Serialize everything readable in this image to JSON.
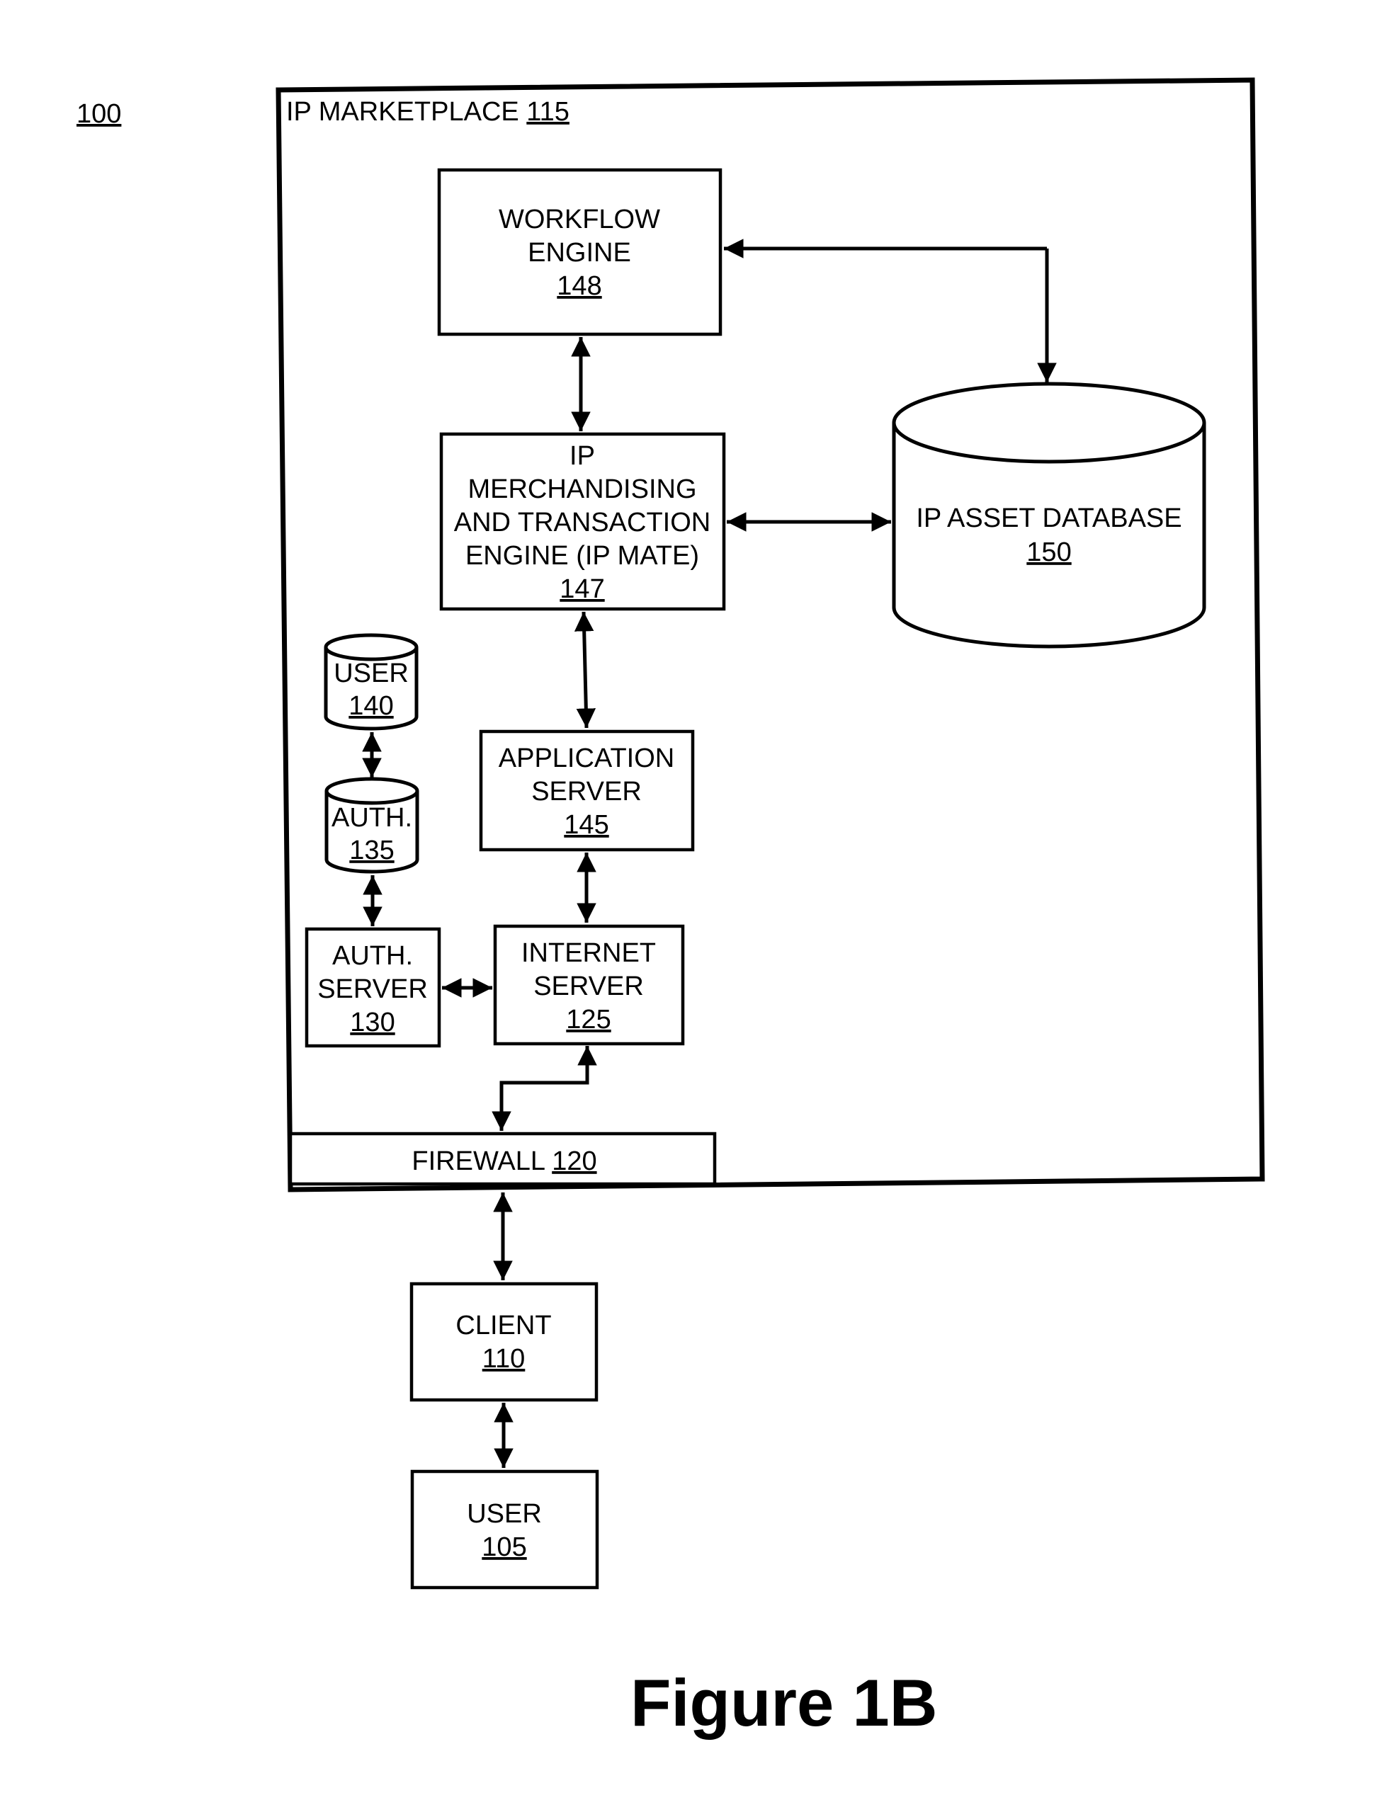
{
  "figure": {
    "reference": "100",
    "caption": "Figure 1B"
  },
  "marketplace": {
    "title": "IP MARKETPLACE",
    "ref": "115"
  },
  "nodes": {
    "workflow_engine": {
      "lines": [
        "WORKFLOW",
        "ENGINE"
      ],
      "ref": "148"
    },
    "ip_mate": {
      "lines": [
        "IP",
        "MERCHANDISING",
        "AND TRANSACTION",
        "ENGINE (IP MATE)"
      ],
      "ref": "147"
    },
    "ip_asset_database": {
      "lines": [
        "IP ASSET DATABASE"
      ],
      "ref": "150"
    },
    "user_db": {
      "lines": [
        "USER"
      ],
      "ref": "140"
    },
    "auth_db": {
      "lines": [
        "AUTH."
      ],
      "ref": "135"
    },
    "application_server": {
      "lines": [
        "APPLICATION",
        "SERVER"
      ],
      "ref": "145"
    },
    "auth_server": {
      "lines": [
        "AUTH.",
        "SERVER"
      ],
      "ref": "130"
    },
    "internet_server": {
      "lines": [
        "INTERNET",
        "SERVER"
      ],
      "ref": "125"
    },
    "firewall": {
      "label": "FIREWALL",
      "ref": "120"
    },
    "client": {
      "lines": [
        "CLIENT"
      ],
      "ref": "110"
    },
    "user": {
      "lines": [
        "USER"
      ],
      "ref": "105"
    }
  },
  "connections": [
    {
      "from": "workflow_engine",
      "to": "ip_asset_database",
      "type": "bidirectional"
    },
    {
      "from": "workflow_engine",
      "to": "ip_mate",
      "type": "bidirectional"
    },
    {
      "from": "ip_mate",
      "to": "ip_asset_database",
      "type": "bidirectional"
    },
    {
      "from": "ip_mate",
      "to": "application_server",
      "type": "bidirectional"
    },
    {
      "from": "application_server",
      "to": "internet_server",
      "type": "bidirectional"
    },
    {
      "from": "user_db",
      "to": "auth_db",
      "type": "bidirectional"
    },
    {
      "from": "auth_db",
      "to": "auth_server",
      "type": "bidirectional"
    },
    {
      "from": "auth_server",
      "to": "internet_server",
      "type": "bidirectional"
    },
    {
      "from": "internet_server",
      "to": "firewall",
      "type": "bidirectional"
    },
    {
      "from": "firewall",
      "to": "client",
      "type": "bidirectional"
    },
    {
      "from": "client",
      "to": "user",
      "type": "bidirectional"
    }
  ]
}
